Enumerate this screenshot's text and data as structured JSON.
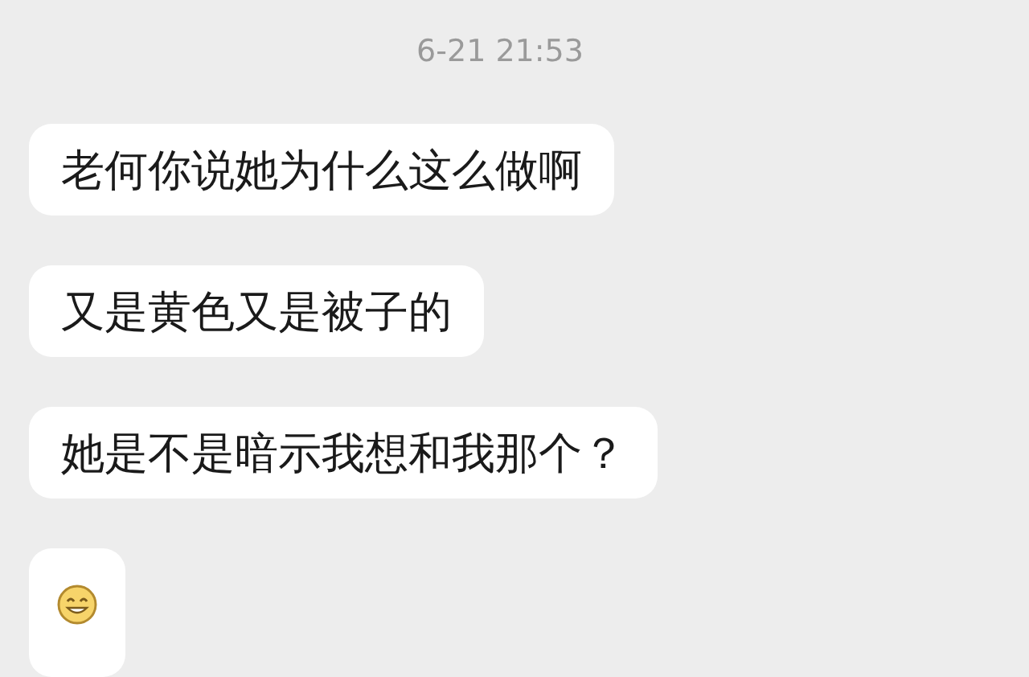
{
  "timestamp": "6-21 21:53",
  "messages": [
    {
      "kind": "text",
      "text": "老何你说她为什么这么做啊"
    },
    {
      "kind": "text",
      "text": "又是黄色又是被子的"
    },
    {
      "kind": "text",
      "text": "她是不是暗示我想和我那个？"
    },
    {
      "kind": "emoji"
    }
  ]
}
